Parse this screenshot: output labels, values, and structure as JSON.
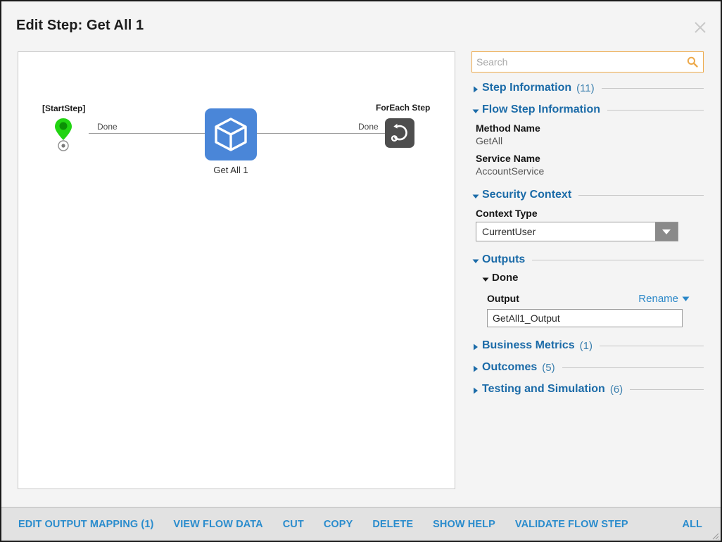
{
  "window": {
    "title": "Edit Step: Get All 1",
    "close_icon": "close-icon"
  },
  "canvas": {
    "start_step": {
      "label": "[StartStep]",
      "icon": "start-pin-icon",
      "connector_label": "Done"
    },
    "flow_step": {
      "caption": "Get All 1",
      "icon": "cube-icon",
      "connector_label": "Done"
    },
    "foreach_step": {
      "label": "ForEach Step",
      "icon": "loop-arrow-icon"
    }
  },
  "panel": {
    "search": {
      "placeholder": "Search",
      "value": "",
      "icon": "search-icon"
    },
    "sections": {
      "step_information": {
        "title": "Step Information",
        "count": "(11)",
        "expanded": false
      },
      "flow_step_information": {
        "title": "Flow Step Information",
        "count": "",
        "expanded": true
      },
      "security_context": {
        "title": "Security Context",
        "count": "",
        "expanded": true
      },
      "outputs": {
        "title": "Outputs",
        "count": "",
        "expanded": true
      },
      "business_metrics": {
        "title": "Business Metrics",
        "count": "(1)",
        "expanded": false
      },
      "outcomes": {
        "title": "Outcomes",
        "count": "(5)",
        "expanded": false
      },
      "testing_and_simulation": {
        "title": "Testing and Simulation",
        "count": "(6)",
        "expanded": false
      }
    },
    "fields": {
      "method_name_label": "Method Name",
      "method_name_value": "GetAll",
      "service_name_label": "Service Name",
      "service_name_value": "AccountService",
      "context_type_label": "Context Type",
      "context_type_value": "CurrentUser"
    },
    "outputs": {
      "done_label": "Done",
      "output_label": "Output",
      "rename_label": "Rename",
      "output_value": "GetAll1_Output"
    }
  },
  "toolbar": {
    "edit_output_mapping": "EDIT OUTPUT MAPPING (1)",
    "view_flow_data": "VIEW FLOW DATA",
    "cut": "CUT",
    "copy": "COPY",
    "delete": "DELETE",
    "show_help": "SHOW HELP",
    "validate_flow_step": "VALIDATE FLOW STEP",
    "all": "ALL"
  },
  "colors": {
    "accent_blue": "#2a8ccd",
    "section_blue": "#1b6ba8",
    "search_border": "#eda94a",
    "node_blue": "#4a86d8",
    "foreach_gray": "#4e4e4e",
    "start_green": "#22d412",
    "dialog_bg": "#f4f4f4",
    "toolbar_bg": "#e2e2e2"
  }
}
